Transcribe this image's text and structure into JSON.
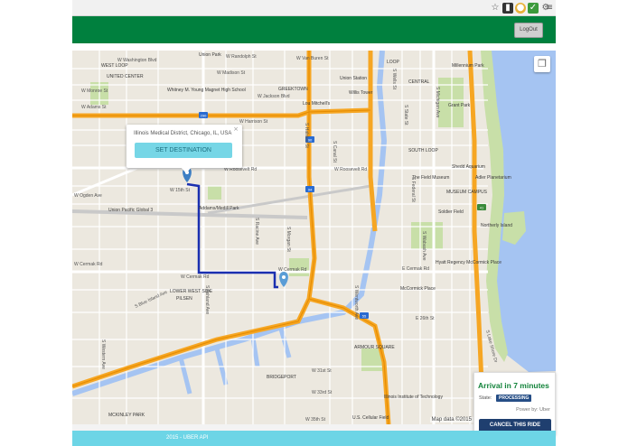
{
  "browser": {
    "icons": [
      "star-icon",
      "kiwi-extension-icon",
      "app-extension-icon",
      "lastpass-icon",
      "settings-extension-icon",
      "menu-icon"
    ]
  },
  "header": {
    "logout_label": "LogOut",
    "color": "#00803e"
  },
  "map": {
    "popup": {
      "address": "Illinois Medical District, Chicago, IL, USA",
      "set_destination_label": "SET DESTINATION",
      "close_glyph": "×"
    },
    "copyright": "Map data ©2015 Google",
    "layers_icon": "layers-icon",
    "streets": {
      "w_randolph": "W Randolph St",
      "w_madison": "W Madison St",
      "w_jackson": "W Jackson Blvd",
      "w_harrison": "W Harrison St",
      "w_roosevelt": "W Roosevelt Rd",
      "w_roosevelt_2": "W Roosevelt Rd",
      "w_15th": "W 15th St",
      "w_cermak": "W Cermak Rd",
      "w_cermak_2": "W Cermak Rd",
      "w_cermak_3": "W Cermak Rd",
      "e_cermak": "E Cermak Rd",
      "w_31st": "W 31st St",
      "w_33rd": "W 33rd St",
      "w_35th": "W 35th St",
      "e_26th": "E 26th St",
      "s_halsted": "S Halsted St",
      "s_canal": "S Canal St",
      "s_ashland": "S Ashland Ave",
      "s_western": "S Western Ave",
      "s_lake_shore": "S Lake Shore Dr",
      "s_michigan": "S Michigan Ave",
      "s_state": "S State St",
      "s_wabash": "S Wabash Ave",
      "s_wentworth": "S Wentworth Ave",
      "s_racine": "S Racine Ave",
      "s_morgan": "S Morgan St",
      "s_blue_island": "S Blue Island Ave",
      "w_ogden": "W Ogden Ave",
      "w_washington": "W Washington Blvd",
      "w_van_buren": "W Van Buren St",
      "s_wells": "S Wells St",
      "s_federal": "S Federal St",
      "w_monroe": "W Monroe St",
      "w_adams": "W Adams St"
    },
    "places": {
      "west_loop": "WEST LOOP",
      "union_park": "Union Park",
      "united_center": "UNITED CENTER",
      "greektown": "GREEKTOWN",
      "loop": "LOOP",
      "union_station": "Union Station",
      "willis_tower": "Willis Tower",
      "millennium_park": "Millennium Park",
      "grant_park": "Grant Park",
      "shedd": "Shedd Aquarium",
      "field_museum": "The Field Museum",
      "adler": "Adler Planetarium",
      "museum_campus": "MUSEUM CAMPUS",
      "soldier_field": "Soldier Field",
      "northerly_island": "Northerly Island",
      "hyatt": "Hyatt Regency McCormick Place",
      "mccormick": "McCormick Place",
      "mitchells": "Lou Mitchell's",
      "whitney": "Whitney M. Young Magnet High School",
      "union_pacific": "Union Pacific Global 3",
      "addams_medill": "Addams/Medill Park",
      "lower_west_side": "LOWER WEST SIDE",
      "pilsen": "PILSEN",
      "armour_square": "ARMOUR SQUARE",
      "bridgeport": "BRIDGEPORT",
      "mckinley_park": "MCKINLEY PARK",
      "iit": "Illinois Institute of Technology",
      "central": "CENTRAL",
      "cellular_field": "U.S. Cellular Field",
      "south_loop": "SOUTH LOOP"
    },
    "highways": [
      "290",
      "90",
      "94",
      "55",
      "41"
    ]
  },
  "ride": {
    "arrival": "Arrival in 7 minutes",
    "state_label": "State:",
    "state_value": "PROCESSING",
    "powered_by": "Power by: Uber",
    "cancel_label": "CANCEL THIS RIDE",
    "arrival_color": "#12833a"
  },
  "footer": {
    "text": "2015 - UBER API",
    "color": "#6dd5e6"
  },
  "route": {
    "color": "#1a2fb0"
  },
  "colors": {
    "water": "#a5c4f2",
    "park": "#c8dfa8",
    "highway": "#f6a623",
    "arterial": "#ffffff"
  }
}
